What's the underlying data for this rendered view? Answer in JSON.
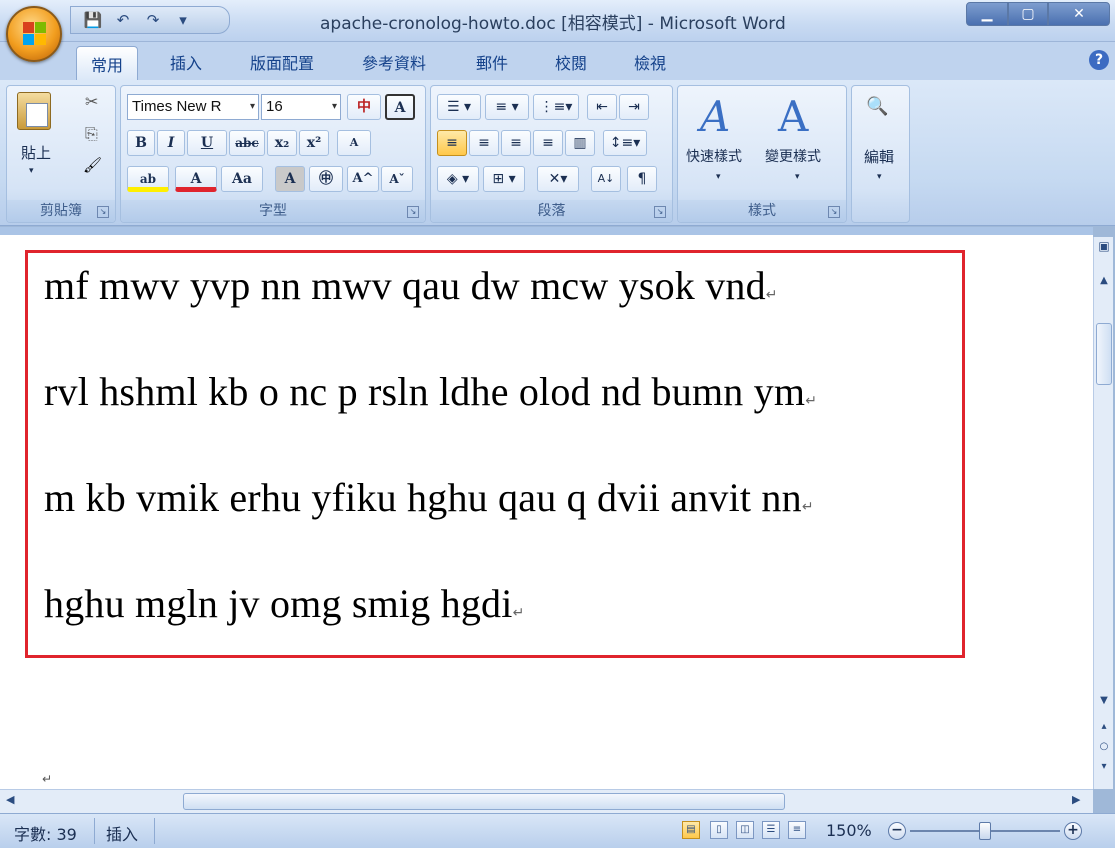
{
  "window": {
    "title": "apache-cronolog-howto.doc [相容模式] - Microsoft Word",
    "minimize": "▁",
    "maximize": "▢",
    "close": "✕"
  },
  "qat": [
    "💾",
    "↶",
    "↷",
    "▾"
  ],
  "tabs": [
    "常用",
    "插入",
    "版面配置",
    "參考資料",
    "郵件",
    "校閱",
    "檢視"
  ],
  "ribbon": {
    "clipboard": {
      "label": "剪貼簿",
      "paste": "貼上",
      "cut": "✂",
      "copy": "⎘",
      "format_painter": "🖌"
    },
    "font": {
      "label": "字型",
      "font_name": "Times New R",
      "font_size": "16",
      "bold": "B",
      "italic": "I",
      "underline": "U",
      "strike": "abc",
      "subscript": "x₂",
      "superscript": "x²",
      "highlight": "ab",
      "font_color": "A",
      "change_case": "Aa",
      "char_shading": "A",
      "enclose": "㊥",
      "grow": "A^",
      "shrink": "Aˇ",
      "phonetic": "中",
      "border": "A",
      "clear": "A"
    },
    "paragraph": {
      "label": "段落"
    },
    "styles": {
      "label": "樣式",
      "quick_styles": "快速樣式",
      "change_styles": "變更樣式"
    },
    "editing": {
      "label": "編輯",
      "find": "🔍"
    }
  },
  "document": {
    "lines": [
      "mf mwv yvp nn mwv qau dw mcw ysok vnd",
      "rvl hshml kb o nc p rsln ldhe olod nd bumn ym",
      "m kb vmik erhu yfiku hghu qau q dvii anvit nn",
      "hghu mgln jv omg smig hgdi"
    ],
    "para_mark": "↵",
    "highlight_color": "#e0242d"
  },
  "statusbar": {
    "word_count": "字數: 39",
    "mode": "插入",
    "zoom": "150%",
    "zoom_out": "−",
    "zoom_in": "+",
    "zoom_level": 0.5
  }
}
